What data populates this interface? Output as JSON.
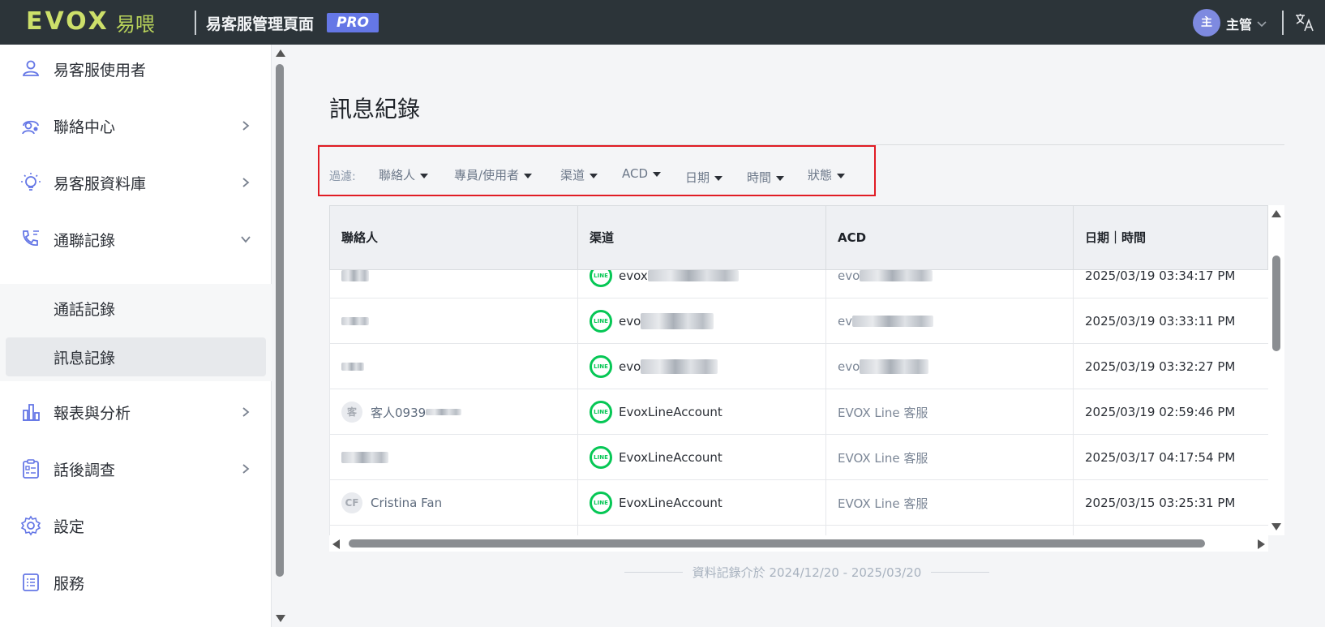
{
  "header": {
    "logo_word": "EVOX",
    "logo_cn": "易喂",
    "app_title": "易客服管理頁面",
    "badge": "PRO",
    "avatar_text": "主",
    "user_name": "主管",
    "icons": {
      "user_menu": "chevron-down-icon",
      "language": "translate-icon"
    }
  },
  "sidebar": {
    "items": [
      {
        "label": "易客服使用者",
        "icon": "person-icon"
      },
      {
        "label": "聯絡中心",
        "icon": "support-agent-icon"
      },
      {
        "label": "易客服資料庫",
        "icon": "lightbulb-icon"
      },
      {
        "label": "通聯記錄",
        "icon": "phone-log-icon"
      },
      {
        "label": "報表與分析",
        "icon": "bar-chart-icon"
      },
      {
        "label": "話後調查",
        "icon": "survey-icon"
      },
      {
        "label": "設定",
        "icon": "gear-icon"
      },
      {
        "label": "服務",
        "icon": "list-icon"
      }
    ],
    "sub_items": [
      {
        "label": "通話記錄"
      },
      {
        "label": "訊息記錄",
        "active": true
      }
    ]
  },
  "main": {
    "title": "訊息紀錄",
    "filter_label": "過濾:",
    "filters": [
      "聯絡人",
      "專員/使用者",
      "渠道",
      "ACD",
      "日期",
      "時間",
      "狀態"
    ],
    "filter_highlight_color": "#e11c24"
  },
  "table": {
    "columns": [
      "聯絡人",
      "渠道",
      "ACD",
      "日期｜時間"
    ],
    "rows": [
      {
        "contact": "",
        "channel": "evox",
        "acd": "evo",
        "datetime": "2025/03/19 03:34:17 PM"
      },
      {
        "contact": "",
        "channel": "evo",
        "acd": "ev",
        "datetime": "2025/03/19 03:33:11 PM"
      },
      {
        "contact": "",
        "channel": "evo",
        "acd": "evo",
        "datetime": "2025/03/19 03:32:27 PM"
      },
      {
        "contact_avatar": "客",
        "contact": "客人0939",
        "channel": "EvoxLineAccount",
        "acd": "EVOX Line 客服",
        "datetime": "2025/03/19 02:59:46 PM"
      },
      {
        "contact": "",
        "channel": "EvoxLineAccount",
        "acd": "EVOX Line 客服",
        "datetime": "2025/03/17 04:17:54 PM"
      },
      {
        "contact_avatar": "CF",
        "contact": "Cristina Fan",
        "channel": "EvoxLineAccount",
        "acd": "EVOX Line 客服",
        "datetime": "2025/03/15 03:25:31 PM"
      }
    ],
    "channel_icon_label": "LINE"
  },
  "footer": {
    "note": "資料記錄介於 2024/12/20 - 2025/03/20"
  },
  "colors": {
    "topbar": "#2c3439",
    "accent": "#6577e6",
    "line_green": "#06c755"
  }
}
